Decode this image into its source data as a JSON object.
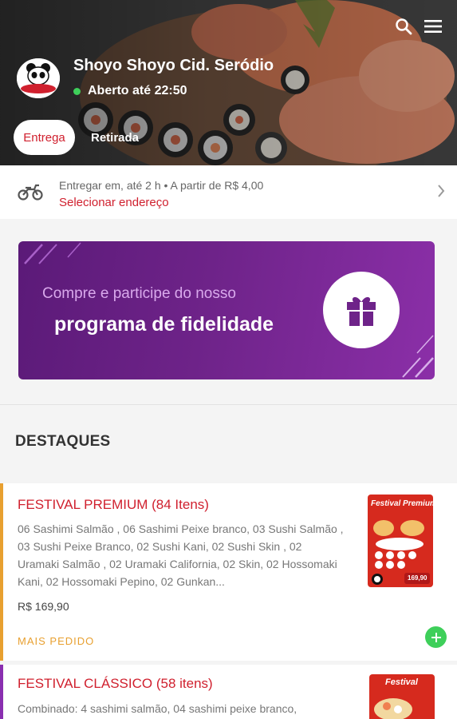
{
  "store": {
    "name": "Shoyo Shoyo Cid. Seródio",
    "status": "Aberto até 22:50",
    "logo_text": "Shoyo Shoyo"
  },
  "tabs": {
    "delivery": "Entrega",
    "pickup": "Retirada"
  },
  "delivery": {
    "info": "Entregar em, até 2 h  •  A partir de R$ 4,00",
    "link": "Selecionar endereço"
  },
  "banner": {
    "line1": "Compre e participe do nosso",
    "line2": "programa de fidelidade"
  },
  "highlights": {
    "title": "DESTAQUES",
    "items": [
      {
        "title": "FESTIVAL PREMIUM (84 Itens)",
        "description": "06 Sashimi Salmão , 06 Sashimi Peixe branco, 03 Sushi Salmão , 03 Sushi Peixe Branco, 02 Sushi Kani, 02 Sushi Skin , 02 Uramaki Salmão , 02 Uramaki California, 02 Skin, 02 Hossomaki Kani, 02 Hossomaki Pepino, 02 Gunkan...",
        "price": "R$ 169,90",
        "tag": "MAIS PEDIDO",
        "thumb_title": "Festival Premium",
        "thumb_price": "169,90",
        "bar_color": "#e8a030"
      },
      {
        "title": "FESTIVAL CLÁSSICO (58 itens)",
        "description": "Combinado: 4 sashimi salmão, 04 sashimi peixe branco,",
        "thumb_title": "Festival",
        "bar_color": "#8a2fb0"
      }
    ]
  },
  "colors": {
    "brand_red": "#d0202e",
    "open_green": "#3ecf5a",
    "banner_purple": "#6e2389"
  }
}
